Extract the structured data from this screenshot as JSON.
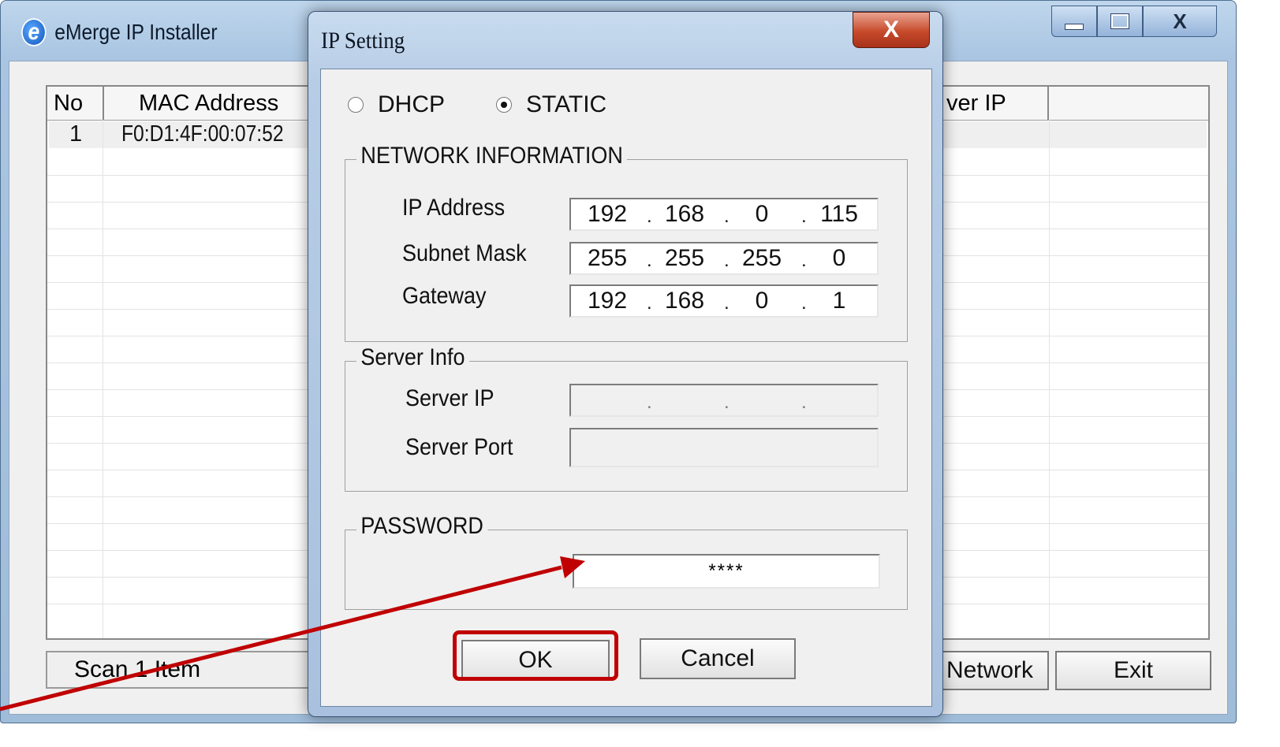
{
  "main_window": {
    "title": "eMerge IP Installer",
    "app_icon_letter": "e",
    "caption_buttons": [
      "minimize",
      "maximize",
      "close"
    ],
    "close_label": "X"
  },
  "list": {
    "columns": [
      "No",
      "MAC Address",
      "ver IP",
      ""
    ],
    "rows": [
      {
        "no": "1",
        "mac": "F0:D1:4F:00:07:52"
      }
    ]
  },
  "status": "Scan 1 Item",
  "buttons": {
    "network": "Network",
    "exit": "Exit"
  },
  "dialog": {
    "title": "IP Setting",
    "close_label": "X",
    "mode": {
      "dhcp_label": "DHCP",
      "static_label": "STATIC",
      "selected": "STATIC"
    },
    "network": {
      "group_label": "NETWORK INFORMATION",
      "ip_label": "IP Address",
      "ip": [
        "192",
        "168",
        "0",
        "115"
      ],
      "mask_label": "Subnet Mask",
      "mask": [
        "255",
        "255",
        "255",
        "0"
      ],
      "gateway_label": "Gateway",
      "gateway": [
        "192",
        "168",
        "0",
        "1"
      ]
    },
    "server": {
      "group_label": "Server Info",
      "ip_label": "Server IP",
      "ip_dots": ".",
      "port_label": "Server Port"
    },
    "password": {
      "group_label": "PASSWORD",
      "value": "****"
    },
    "ok_label": "OK",
    "cancel_label": "Cancel"
  },
  "annotation": {
    "color": "#c00000"
  }
}
